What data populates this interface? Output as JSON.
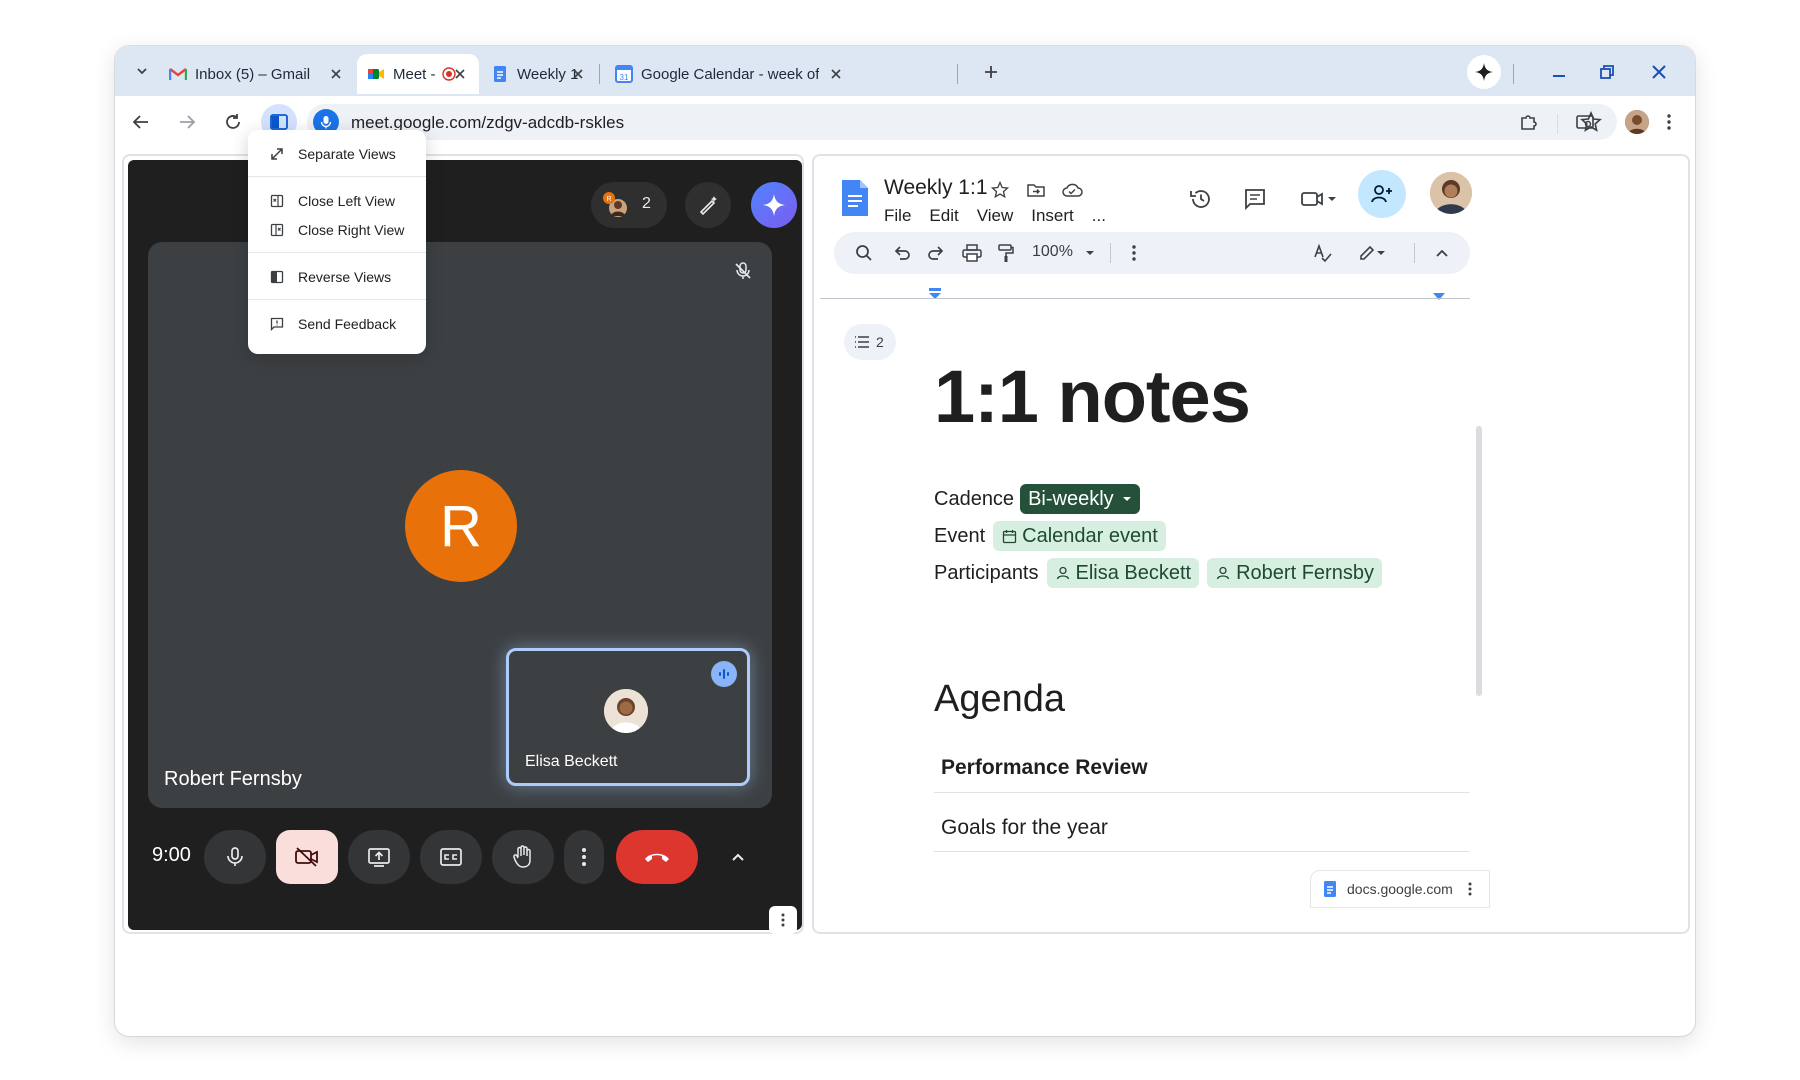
{
  "colors": {
    "accent": "#1a73e8",
    "meet_background": "#1f1f1f",
    "avatar_orange": "#e8710a",
    "leave_red": "#dc362e",
    "chip_green": "#d7efe1",
    "chip_dark_green": "#25503a"
  },
  "tabs": [
    {
      "label": "Inbox (5) – Gmail",
      "icon": "gmail-icon"
    },
    {
      "label": "Meet -",
      "icon": "meet-icon",
      "active": true
    },
    {
      "label": "Weekly 1",
      "icon": "docs-icon"
    },
    {
      "label": "Google Calendar - week of",
      "icon": "calendar-icon"
    }
  ],
  "address_bar": {
    "url": "meet.google.com/zdgv-adcdb-rskles"
  },
  "split_menu": {
    "items": [
      {
        "label": "Separate Views",
        "icon": "expand-icon"
      },
      {
        "label": "Close Left View",
        "icon": "close-left-view-icon"
      },
      {
        "label": "Close Right View",
        "icon": "close-right-view-icon"
      },
      {
        "label": "Reverse Views",
        "icon": "reverse-views-icon"
      },
      {
        "label": "Send Feedback",
        "icon": "feedback-icon"
      }
    ]
  },
  "meet": {
    "participant_count": "2",
    "main_participant": {
      "initial": "R",
      "name": "Robert Fernsby"
    },
    "pip_participant": {
      "name": "Elisa Beckett"
    },
    "time": "9:00"
  },
  "docs": {
    "title": "Weekly 1:1",
    "menu": [
      "File",
      "Edit",
      "View",
      "Insert",
      "..."
    ],
    "zoom": "100%",
    "outline_count": "2",
    "heading": "1:1 notes",
    "properties": {
      "cadence_label": "Cadence",
      "cadence_value": "Bi-weekly",
      "event_label": "Event",
      "event_value": "Calendar event",
      "participants_label": "Participants",
      "participants": [
        "Elisa Beckett",
        "Robert Fernsby"
      ]
    },
    "agenda_heading": "Agenda",
    "agenda_items": [
      "Performance Review",
      "Goals for the year"
    ],
    "origin": "docs.google.com"
  }
}
